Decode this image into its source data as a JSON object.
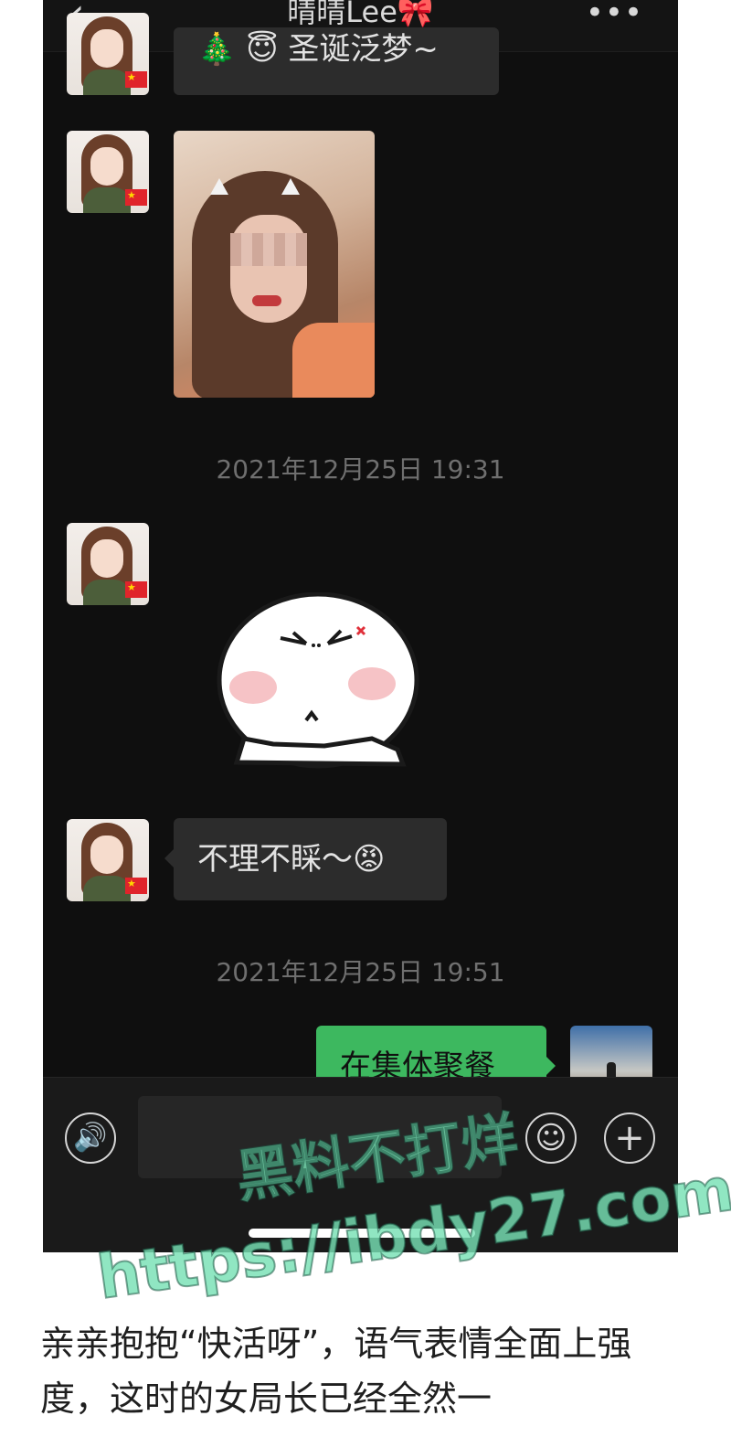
{
  "nav": {
    "title": "晴晴Lee🎀",
    "back_icon": "‹",
    "more_icon": "•••"
  },
  "messages": {
    "top_bubble_text": "🎄 😇 圣诞泛梦~",
    "timestamp_1": "2021年12月25日 19:31",
    "reply_text": "不理不睬～",
    "reply_emoji": "😡",
    "timestamp_2": "2021年12月25日 19:51",
    "sent_text": "在集体聚餐"
  },
  "input_bar": {
    "voice_icon": "🔊",
    "emoji_icon": "☺",
    "plus_icon": "+"
  },
  "watermark": {
    "line1": "黑料不打烊",
    "line2": ".com",
    "url": "https://ibdy27"
  },
  "article": {
    "text": "亲亲抱抱“快活呀”，语气表情全面上强度，这时的女局长已经全然一"
  },
  "colors": {
    "chat_background": "#0f0f0f",
    "received_bubble": "#2c2c2c",
    "sent_bubble": "#3db85f",
    "watermark": "#78e1b4"
  }
}
